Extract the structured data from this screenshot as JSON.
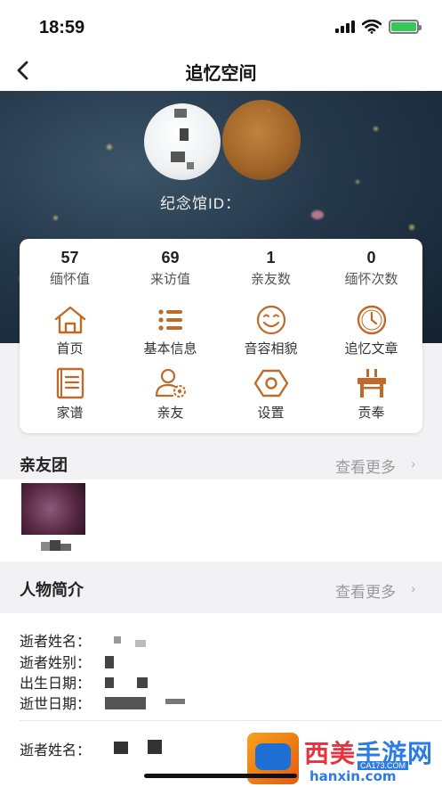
{
  "status_bar": {
    "time": "18:59"
  },
  "nav": {
    "title": "追忆空间"
  },
  "hero": {
    "memorial_id": "纪念馆ID："
  },
  "stats": [
    {
      "value": "57",
      "label": "缅怀值"
    },
    {
      "value": "69",
      "label": "来访值"
    },
    {
      "value": "1",
      "label": "亲友数"
    },
    {
      "value": "0",
      "label": "缅怀次数"
    }
  ],
  "menu": [
    {
      "label": "首页",
      "icon": "home-icon"
    },
    {
      "label": "基本信息",
      "icon": "list-icon"
    },
    {
      "label": "音容相貌",
      "icon": "smiley-icon"
    },
    {
      "label": "追忆文章",
      "icon": "clock-icon"
    },
    {
      "label": "家谱",
      "icon": "book-icon"
    },
    {
      "label": "亲友",
      "icon": "user-settings-icon"
    },
    {
      "label": "设置",
      "icon": "hex-nut-icon"
    },
    {
      "label": "贡奉",
      "icon": "altar-table-icon"
    }
  ],
  "friends_section": {
    "title": "亲友团",
    "more": "查看更多"
  },
  "profile_section": {
    "title": "人物简介",
    "more": "查看更多",
    "rows": [
      "逝者姓名：",
      "逝者姓别：",
      "出生日期：",
      "逝世日期："
    ],
    "second_name_label": "逝者姓名："
  },
  "watermark": {
    "title_red": "西美",
    "title_blue": "手游网",
    "url": "hanxin.com",
    "badge": "CA173.COM"
  },
  "colors": {
    "accent": "#c06a2a",
    "hero_bg": "#25384a",
    "battery": "#36c759"
  }
}
